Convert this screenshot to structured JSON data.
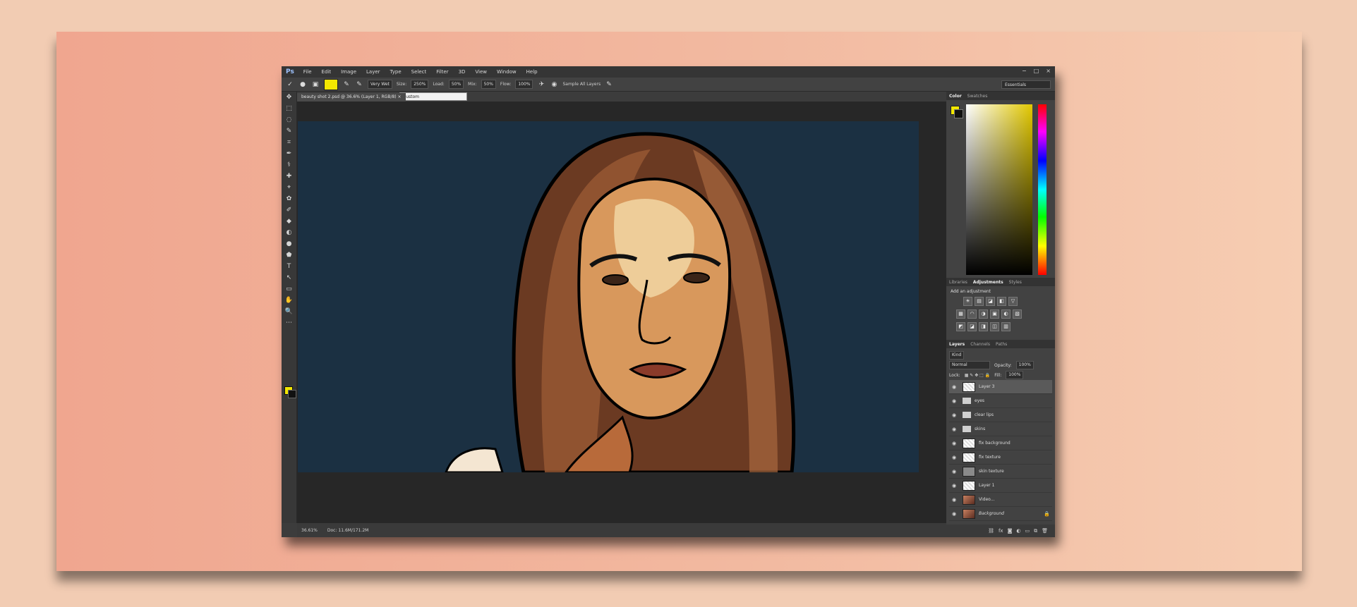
{
  "app": {
    "logo": "Ps"
  },
  "menu": [
    "File",
    "Edit",
    "Image",
    "Layer",
    "Type",
    "Select",
    "Filter",
    "3D",
    "View",
    "Window",
    "Help"
  ],
  "window_controls": [
    "−",
    "□",
    "×"
  ],
  "options_bar": {
    "brush_preset": "Very Wet",
    "size_label": "Size:",
    "size_value": "250%",
    "load_label": "Load:",
    "load_value": "50%",
    "mix_label": "Mix:",
    "mix_value": "50%",
    "flow_label": "Flow:",
    "flow_value": "100%",
    "sample_all_layers": "Sample All Layers",
    "workspace": "Essentials",
    "dropdown_popup": "Custom"
  },
  "document_tab": "beauty shot 2.psd @ 36.6% (Layer 1, RGB/8) ×",
  "toolbar_tools": [
    "✥",
    "⬚",
    "◌",
    "✎",
    "⌗",
    "✒",
    "⚕",
    "✚",
    "⌖",
    "✿",
    "✐",
    "◆",
    "◐",
    "●",
    "⬟",
    "T",
    "↖",
    "▭",
    "✋",
    "🔍",
    "⋯"
  ],
  "colors": {
    "foreground": "#f3e700",
    "background": "#111111",
    "canvas_bg": "#1b3042"
  },
  "color_panel": {
    "tabs": [
      "Color",
      "Swatches"
    ]
  },
  "adjustments_panel": {
    "tabs": [
      "Libraries",
      "Adjustments",
      "Styles"
    ],
    "title": "Add an adjustment",
    "row1": [
      "☀",
      "▤",
      "◪",
      "◧",
      "▽"
    ],
    "row2": [
      "▦",
      "◠",
      "◑",
      "▣",
      "◐",
      "▧"
    ],
    "row3": [
      "◩",
      "◪",
      "◨",
      "◫",
      "▥"
    ]
  },
  "layers_panel": {
    "tabs": [
      "Layers",
      "Channels",
      "Paths"
    ],
    "kind_filter": "Kind",
    "blend_mode": "Normal",
    "opacity_label": "Opacity:",
    "opacity_value": "100%",
    "lock_label": "Lock:",
    "fill_label": "Fill:",
    "fill_value": "100%",
    "layers": [
      {
        "name": "Layer 3",
        "thumb": "checker",
        "selected": true
      },
      {
        "name": "eyes",
        "thumb": "folder"
      },
      {
        "name": "clear lips",
        "thumb": "folder"
      },
      {
        "name": "skins",
        "thumb": "folder"
      },
      {
        "name": "fix background",
        "thumb": "checker"
      },
      {
        "name": "fix texture",
        "thumb": "checker"
      },
      {
        "name": "skin texture",
        "thumb": "gray"
      },
      {
        "name": "Layer 1",
        "thumb": "checker"
      },
      {
        "name": "Video...",
        "thumb": "photo"
      },
      {
        "name": "Background",
        "thumb": "photo",
        "locked": true
      }
    ],
    "footer_icons": [
      "⛓",
      "fx",
      "◙",
      "◐",
      "▭",
      "⧉",
      "🗑"
    ]
  },
  "status_bar": {
    "zoom": "36.61%",
    "doc_info": "Doc: 11.6M/171.2M"
  }
}
